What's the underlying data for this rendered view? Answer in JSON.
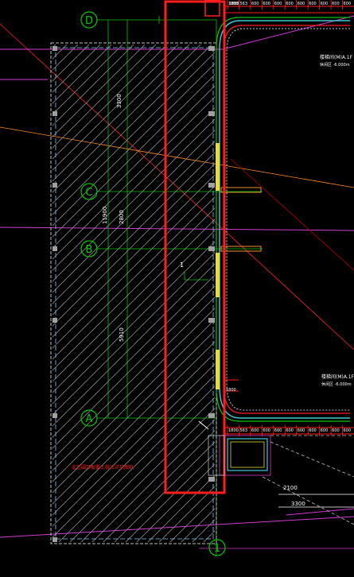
{
  "grid_axes": {
    "d": "D",
    "c": "C",
    "b": "B",
    "a": "A",
    "one": "1"
  },
  "dimensions": {
    "d_c": "3300",
    "total": "11900",
    "c_b": "2800",
    "b_a": "5910",
    "top_row": [
      "1800",
      "563",
      "600",
      "600",
      "600",
      "600",
      "600",
      "600",
      "600",
      "600",
      "600"
    ],
    "bottom_row": [
      "1800",
      "563",
      "600",
      "600",
      "600",
      "600",
      "600",
      "600",
      "600",
      "600",
      "600"
    ],
    "side_top": "1800",
    "side_bottom": "1800",
    "pit_width": "2100",
    "pit_depth": "3300"
  },
  "labels": {
    "section_top_1": "楼梯间(M)A.1F",
    "section_top_2": "休闲区 -6.000m",
    "section_bottom_1": "楼梯间(M)A.1F",
    "section_bottom_2": "休闲区 -6.000m",
    "marker_1": "1",
    "note_red": "此范围顶板覆土做法详见图纸"
  },
  "colors": {
    "background": "#000000",
    "green": "#00c800",
    "red": "#ff1e1e",
    "white": "#ffffff",
    "magenta": "#d23cd2",
    "cyan": "#40c8d8",
    "yellow": "#e6dc32",
    "orange": "#ff8a1e"
  }
}
